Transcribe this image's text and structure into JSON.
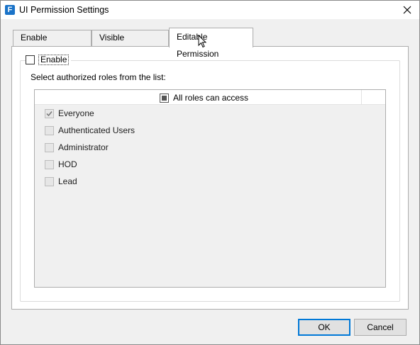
{
  "window": {
    "title": "UI Permission Settings",
    "app_icon_letter": "F"
  },
  "tabs": [
    {
      "label": "Enable Permission",
      "active": false
    },
    {
      "label": "Visible Permission",
      "active": false
    },
    {
      "label": "Editable Permission",
      "active": true
    }
  ],
  "panel": {
    "enable_checkbox": {
      "label": "Enable",
      "checked": false
    },
    "instruction": "Select authorized roles from the list:",
    "list": {
      "header_label": "All roles can access",
      "header_state": "indeterminate",
      "roles": [
        {
          "label": "Everyone",
          "checked": true
        },
        {
          "label": "Authenticated Users",
          "checked": false
        },
        {
          "label": "Administrator",
          "checked": false
        },
        {
          "label": "HOD",
          "checked": false
        },
        {
          "label": "Lead",
          "checked": false
        }
      ]
    }
  },
  "buttons": {
    "ok": "OK",
    "cancel": "Cancel"
  }
}
